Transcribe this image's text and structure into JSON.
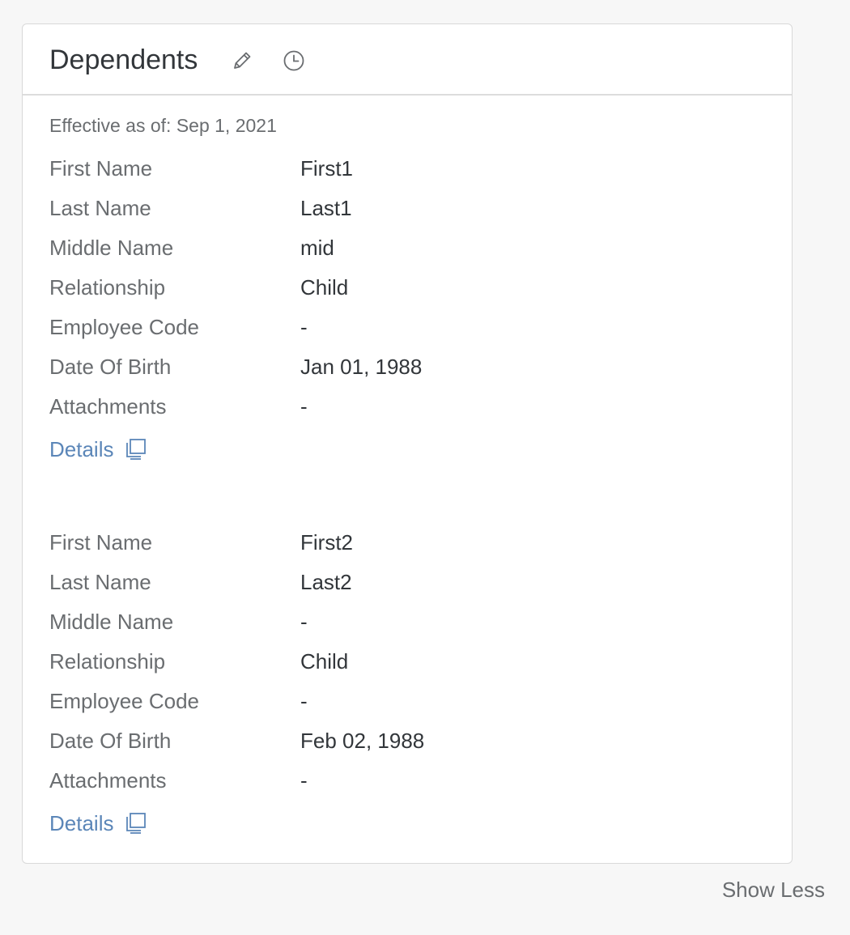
{
  "card": {
    "title": "Dependents",
    "edit_icon": "pencil-icon",
    "history_icon": "clock-icon",
    "effective": "Effective as of: Sep 1, 2021"
  },
  "dependents": [
    {
      "fields": [
        {
          "label": "First Name",
          "value": "First1"
        },
        {
          "label": "Last Name",
          "value": "Last1"
        },
        {
          "label": "Middle Name",
          "value": "mid"
        },
        {
          "label": "Relationship",
          "value": "Child"
        },
        {
          "label": "Employee Code",
          "value": "-"
        },
        {
          "label": "Date Of Birth",
          "value": "Jan 01, 1988"
        },
        {
          "label": "Attachments",
          "value": "-"
        }
      ],
      "details_label": "Details"
    },
    {
      "fields": [
        {
          "label": "First Name",
          "value": "First2"
        },
        {
          "label": "Last Name",
          "value": "Last2"
        },
        {
          "label": "Middle Name",
          "value": "-"
        },
        {
          "label": "Relationship",
          "value": "Child"
        },
        {
          "label": "Employee Code",
          "value": "-"
        },
        {
          "label": "Date Of Birth",
          "value": "Feb 02, 1988"
        },
        {
          "label": "Attachments",
          "value": "-"
        }
      ],
      "details_label": "Details"
    }
  ],
  "footer": {
    "show_less_label": "Show Less"
  },
  "colors": {
    "link": "#5b86b8",
    "label": "#6a6d70",
    "value": "#32363a"
  }
}
